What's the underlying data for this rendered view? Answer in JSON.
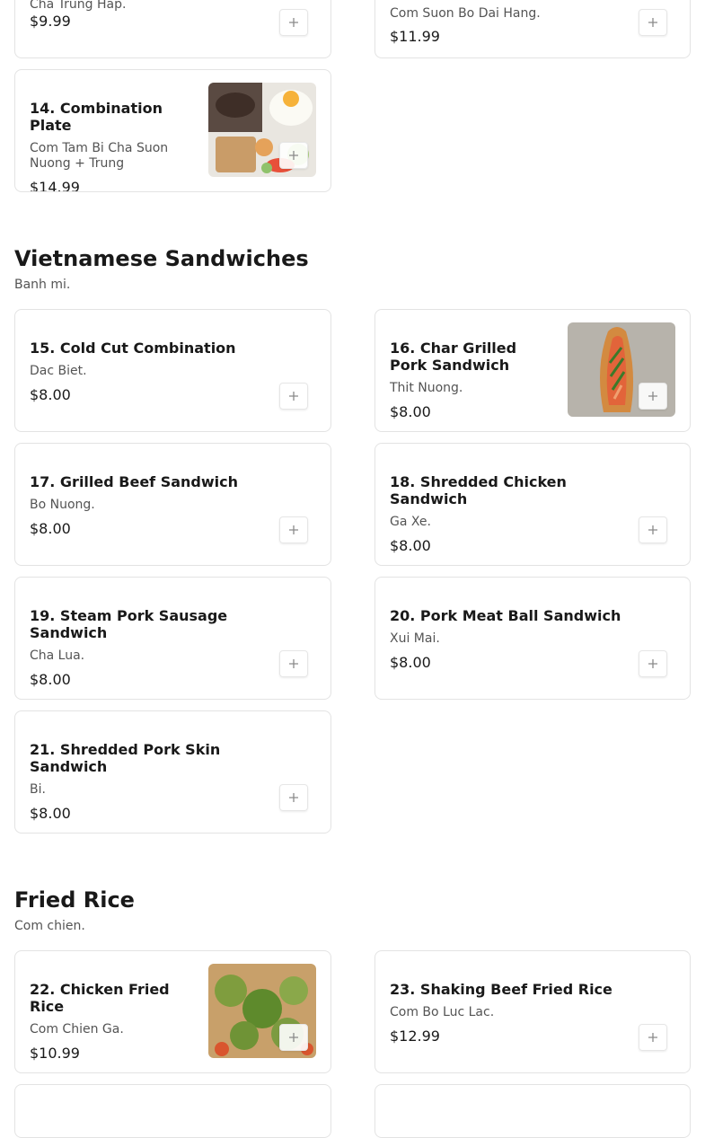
{
  "items": {
    "i13": {
      "desc": "Cha Trung Hap.",
      "price": "$9.99"
    },
    "i13b": {
      "desc": "Com Suon Bo Dai Hang.",
      "price": "$11.99"
    },
    "i14": {
      "title": "14. Combination Plate",
      "desc": "Com Tam Bi Cha Suon Nuong + Trung",
      "price": "$14.99"
    },
    "i15": {
      "title": "15. Cold Cut Combination",
      "desc": "Dac Biet.",
      "price": "$8.00"
    },
    "i16": {
      "title": "16. Char Grilled Pork Sandwich",
      "desc": "Thit Nuong.",
      "price": "$8.00"
    },
    "i17": {
      "title": "17. Grilled Beef Sandwich",
      "desc": "Bo Nuong.",
      "price": "$8.00"
    },
    "i18": {
      "title": "18. Shredded Chicken Sandwich",
      "desc": "Ga Xe.",
      "price": "$8.00"
    },
    "i19": {
      "title": "19. Steam Pork Sausage Sandwich",
      "desc": "Cha Lua.",
      "price": "$8.00"
    },
    "i20": {
      "title": "20. Pork Meat Ball Sandwich",
      "desc": "Xui Mai.",
      "price": "$8.00"
    },
    "i21": {
      "title": "21. Shredded Pork Skin Sandwich",
      "desc": "Bi.",
      "price": "$8.00"
    },
    "i22": {
      "title": "22. Chicken Fried Rice",
      "desc": "Com Chien Ga.",
      "price": "$10.99"
    },
    "i23": {
      "title": "23. Shaking Beef Fried Rice",
      "desc": "Com Bo Luc Lac.",
      "price": "$12.99"
    }
  },
  "sections": {
    "sandwiches": {
      "title": "Vietnamese Sandwiches",
      "subtitle": "Banh mi."
    },
    "fried_rice": {
      "title": "Fried Rice",
      "subtitle": "Com chien."
    }
  },
  "icons": {
    "add": "plus-icon"
  },
  "colors": {
    "text": "#191919",
    "muted": "#545454",
    "border": "#e3e3e3"
  }
}
